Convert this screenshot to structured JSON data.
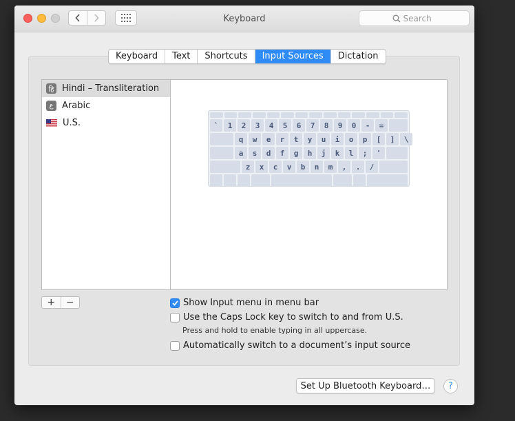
{
  "window": {
    "title": "Keyboard",
    "search_placeholder": "Search"
  },
  "toolbar": {
    "back_icon": "chevron-left-icon",
    "forward_icon": "chevron-right-icon",
    "grid_icon": "app-grid-icon",
    "search_icon": "search-icon"
  },
  "tabs": [
    {
      "label": "Keyboard",
      "active": false
    },
    {
      "label": "Text",
      "active": false
    },
    {
      "label": "Shortcuts",
      "active": false
    },
    {
      "label": "Input Sources",
      "active": true
    },
    {
      "label": "Dictation",
      "active": false
    }
  ],
  "sources": [
    {
      "label": "Hindi – Transliteration",
      "icon_text": "हि",
      "selected": true
    },
    {
      "label": "Arabic",
      "icon_text": "ع",
      "selected": false
    },
    {
      "label": "U.S.",
      "icon": "us-flag-icon",
      "selected": false
    }
  ],
  "keyboard": {
    "row1": [
      "`",
      "1",
      "2",
      "3",
      "4",
      "5",
      "6",
      "7",
      "8",
      "9",
      "0",
      "-",
      "="
    ],
    "row2": [
      "q",
      "w",
      "e",
      "r",
      "t",
      "y",
      "u",
      "i",
      "o",
      "p",
      "[",
      "]",
      "\\"
    ],
    "row3": [
      "a",
      "s",
      "d",
      "f",
      "g",
      "h",
      "j",
      "k",
      "l",
      ";",
      "'"
    ],
    "row4": [
      "z",
      "x",
      "c",
      "v",
      "b",
      "n",
      "m",
      ",",
      ".",
      "/"
    ]
  },
  "list_controls": {
    "add": "+",
    "remove": "−"
  },
  "options": {
    "show_input_menu": {
      "label": "Show Input menu in menu bar",
      "checked": true
    },
    "caps_lock": {
      "label": "Use the Caps Lock key to switch to and from U.S.",
      "checked": false
    },
    "caps_lock_hint": "Press and hold to enable typing in all uppercase.",
    "auto_switch": {
      "label": "Automatically switch to a document’s input source",
      "checked": false
    }
  },
  "footer": {
    "bluetooth_button": "Set Up Bluetooth Keyboard…",
    "help": "?"
  },
  "colors": {
    "accent": "#2f8cf7",
    "close": "#fc605c",
    "minimize": "#fdbc40"
  }
}
